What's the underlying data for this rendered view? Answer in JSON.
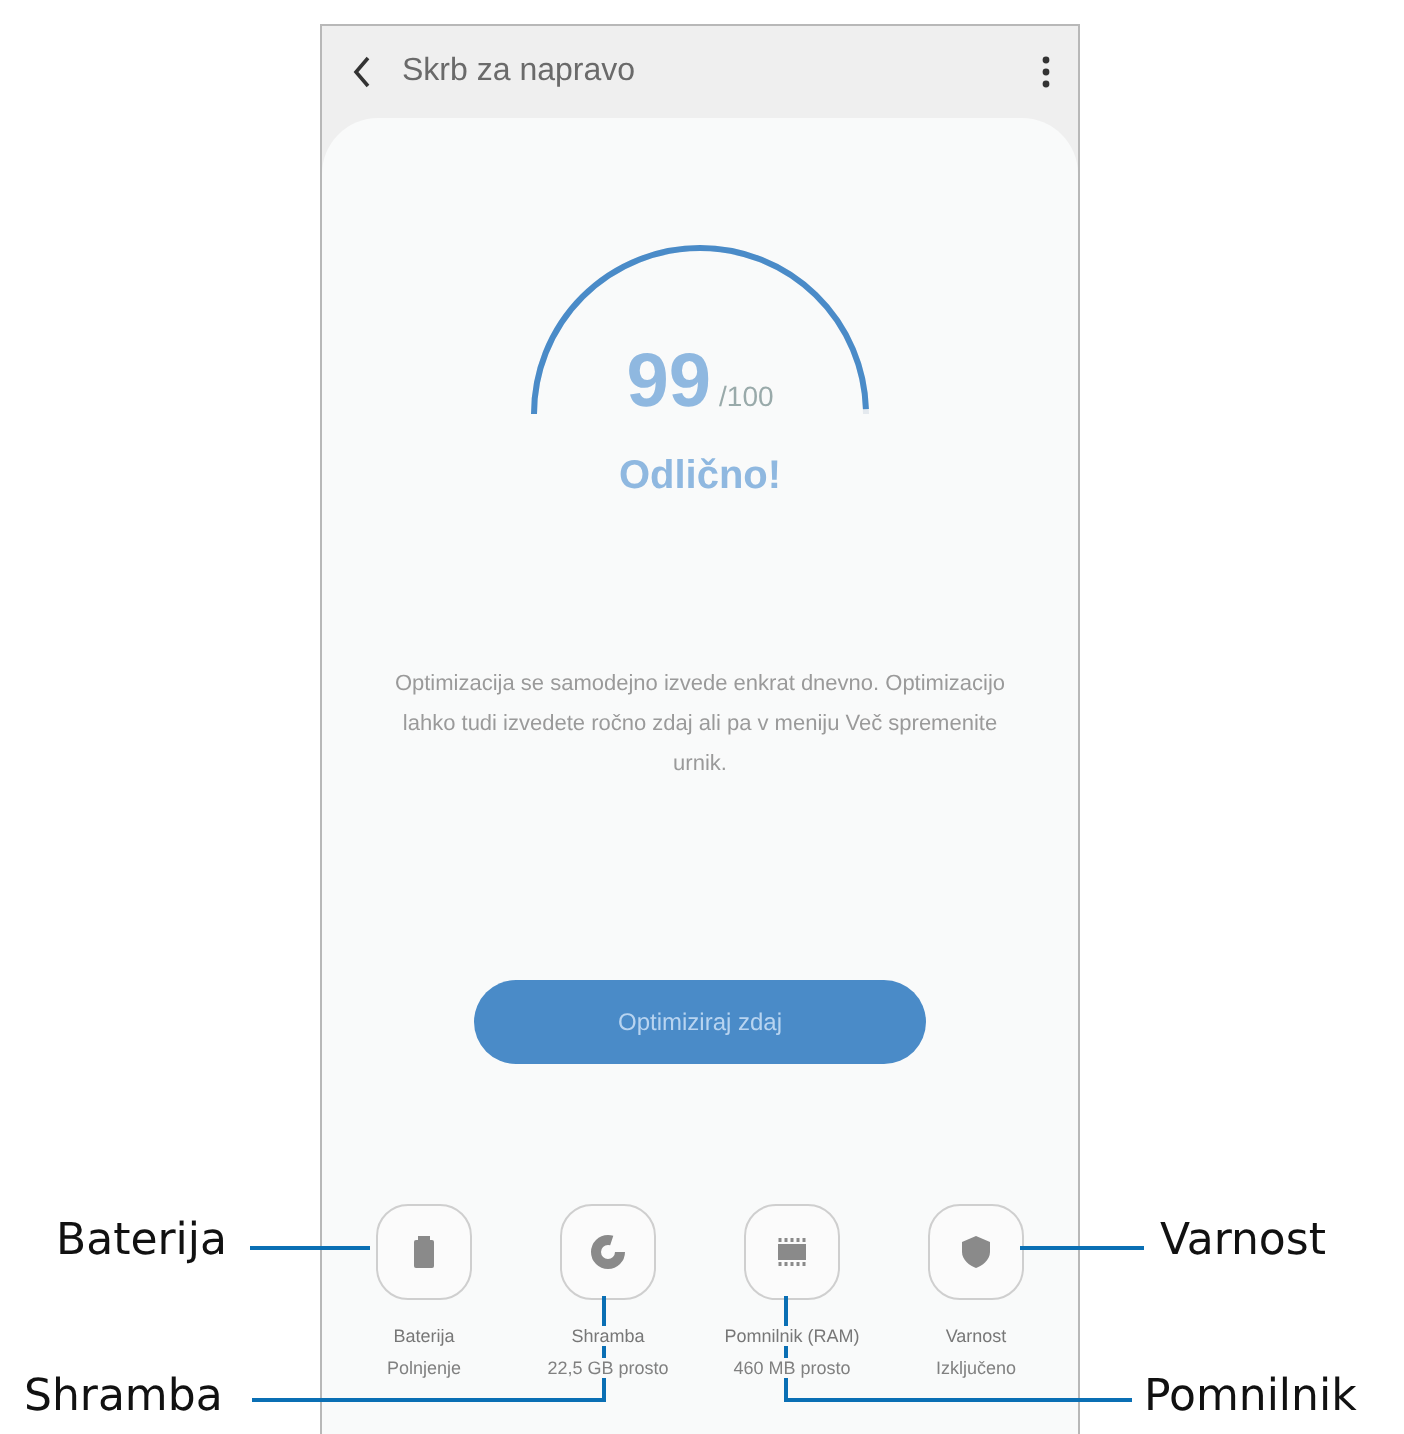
{
  "header": {
    "title": "Skrb za napravo"
  },
  "score": {
    "value": "99",
    "max": "/100",
    "status": "Odlično!",
    "level": 0.99
  },
  "description": "Optimizacija se samodejno izvede enkrat dnevno. Optimizacijo lahko tudi izvedete ročno zdaj ali pa v meniju Več spremenite urnik.",
  "optimize_button": "Optimiziraj zdaj",
  "tiles": [
    {
      "kind": "battery",
      "label": "Baterija",
      "detail": "Polnjenje"
    },
    {
      "kind": "storage",
      "label": "Shramba",
      "detail": "22,5 GB prosto"
    },
    {
      "kind": "memory",
      "label": "Pomnilnik (RAM)",
      "detail": "460 MB prosto"
    },
    {
      "kind": "security",
      "label": "Varnost",
      "detail": "Izključeno"
    }
  ],
  "callouts": [
    {
      "label": "Baterija"
    },
    {
      "label": "Varnost"
    },
    {
      "label": "Shramba"
    },
    {
      "label": "Pomnilnik"
    }
  ]
}
